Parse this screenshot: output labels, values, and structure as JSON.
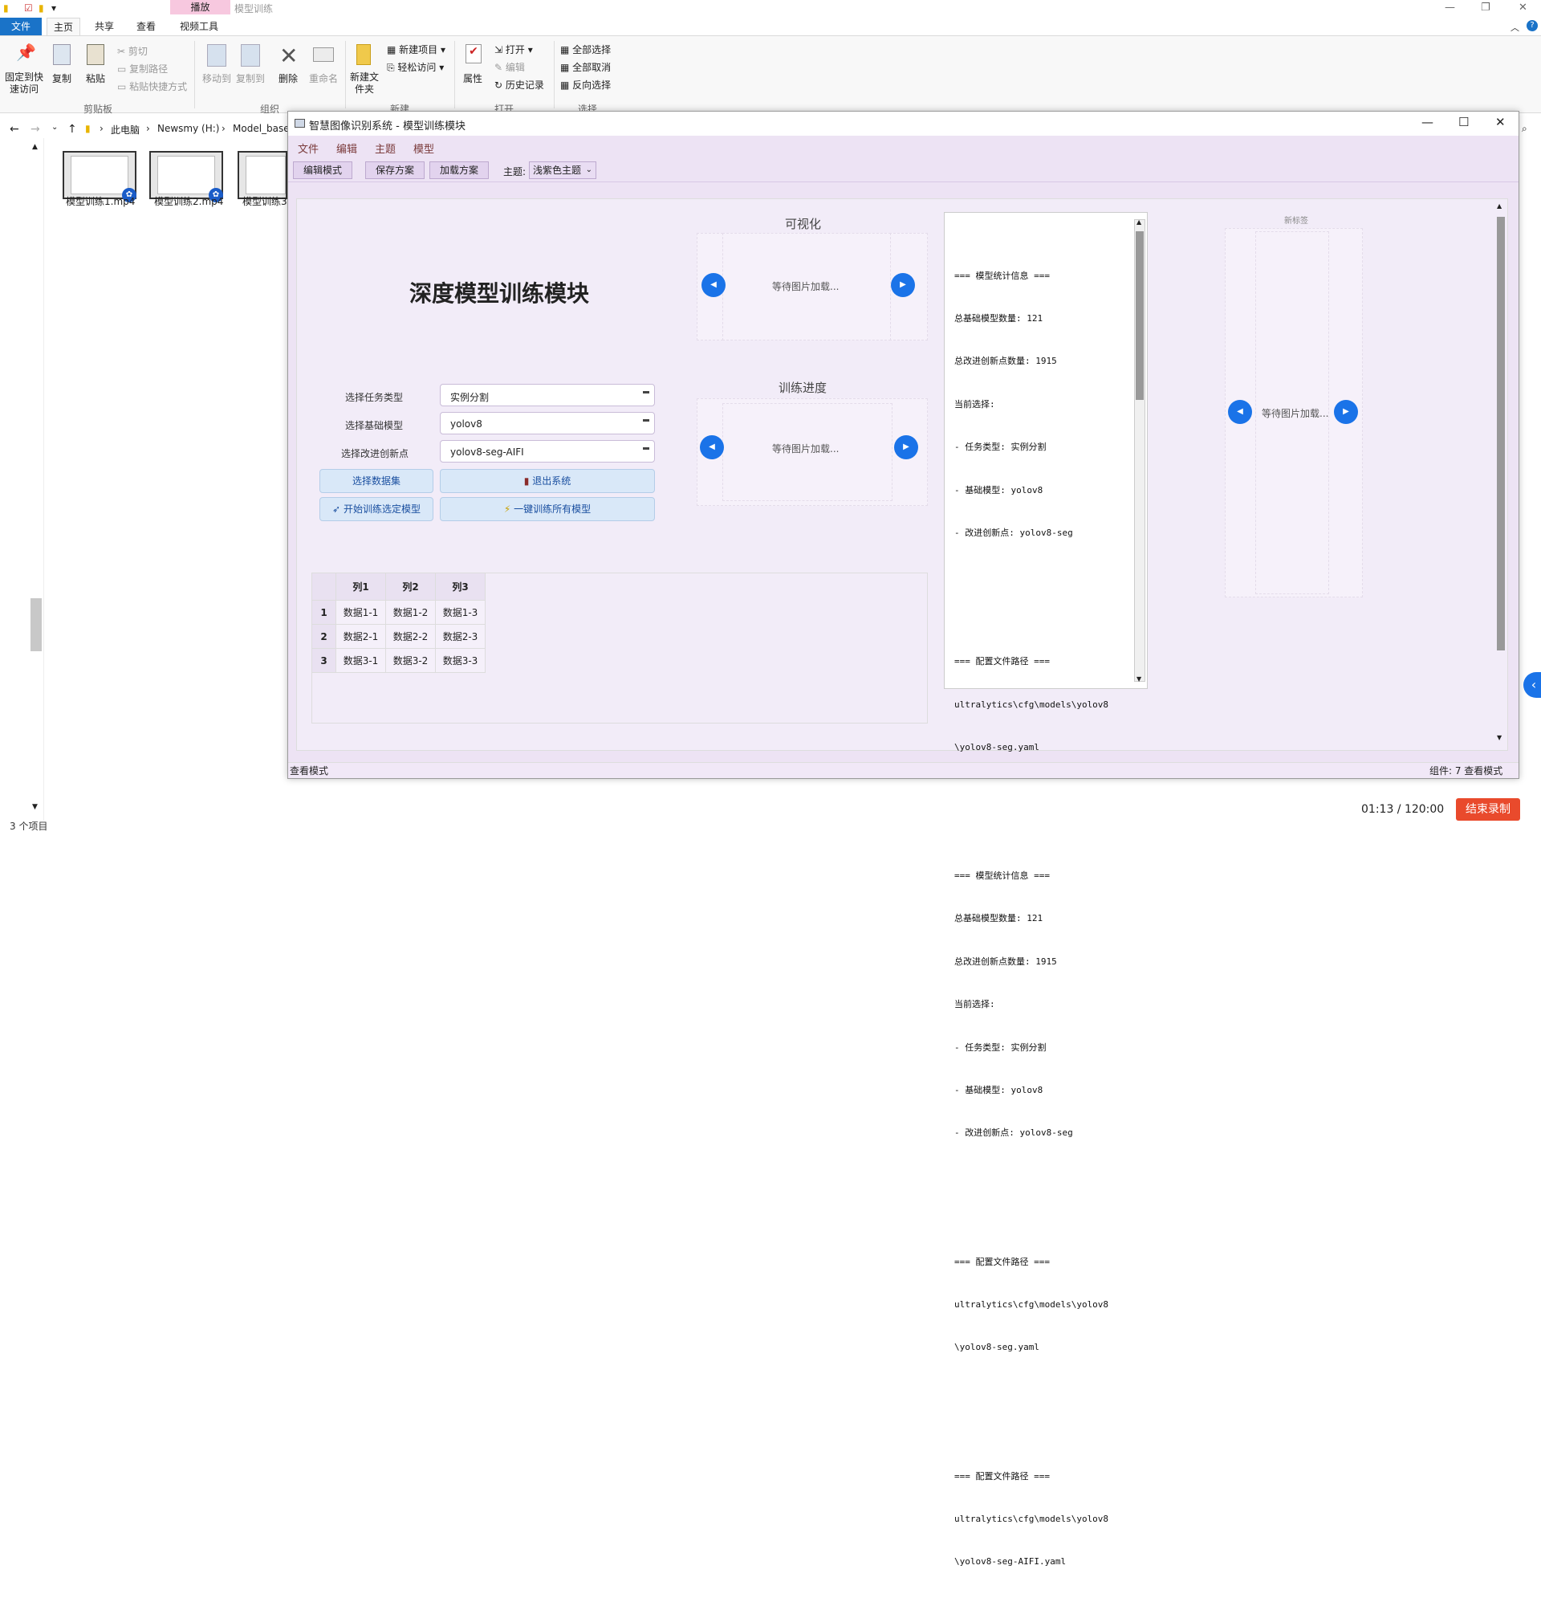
{
  "explorer": {
    "ribbon_tabs": [
      "文件",
      "主页",
      "共享",
      "查看",
      "视频工具"
    ],
    "context_tab": "播放",
    "window_title": "模型训练",
    "clipboard": {
      "pin": "固定到快速访问",
      "copy": "复制",
      "paste": "粘贴",
      "cut": "剪切",
      "copy_path": "复制路径",
      "paste_shortcut": "粘贴快捷方式",
      "group": "剪贴板"
    },
    "organize": {
      "move_to": "移动到",
      "copy_to": "复制到",
      "delete": "删除",
      "rename": "重命名",
      "group": "组织"
    },
    "new": {
      "new_folder": "新建文件夹",
      "new_item": "新建项目",
      "easy_access": "轻松访问",
      "group": "新建"
    },
    "open": {
      "properties": "属性",
      "open": "打开",
      "edit": "编辑",
      "history": "历史记录",
      "group": "打开"
    },
    "select": {
      "select_all": "全部选择",
      "select_none": "全部取消",
      "invert": "反向选择",
      "group": "选择"
    },
    "breadcrumb": [
      "此电脑",
      "Newsmy (H:)",
      "Model_base"
    ],
    "files": [
      "模型训练1.mp4",
      "模型训练2.mp4",
      "模型训练3."
    ],
    "status": "3 个项目"
  },
  "app": {
    "title": "智慧图像识别系统 - 模型训练模块",
    "menu": [
      "文件",
      "编辑",
      "主题",
      "模型"
    ],
    "toolbar": {
      "edit_mode": "编辑模式",
      "save": "保存方案",
      "load": "加载方案",
      "theme_label": "主题:",
      "theme_value": "浅紫色主题"
    },
    "heading": "深度模型训练模块",
    "form": {
      "task_label": "选择任务类型",
      "task_value": "实例分割",
      "base_label": "选择基础模型",
      "base_value": "yolov8",
      "innov_label": "选择改进创新点",
      "innov_value": "yolov8-seg-AIFI"
    },
    "buttons": {
      "dataset": "选择数据集",
      "exit": "退出系统",
      "train_selected": "开始训练选定模型",
      "train_all": "一键训练所有模型"
    },
    "visual_title": "可视化",
    "progress_title": "训练进度",
    "waiting": "等待图片加载...",
    "new_tab": "新标签",
    "log": [
      "=== 模型统计信息 ===",
      "总基础模型数量: 121",
      "总改进创新点数量: 1915",
      "当前选择:",
      "- 任务类型: 实例分割",
      "- 基础模型: yolov8",
      "- 改进创新点: yolov8-seg",
      "",
      "",
      "=== 配置文件路径 ===",
      "ultralytics\\cfg\\models\\yolov8",
      "\\yolov8-seg.yaml",
      "",
      "",
      "=== 模型统计信息 ===",
      "总基础模型数量: 121",
      "总改进创新点数量: 1915",
      "当前选择:",
      "- 任务类型: 实例分割",
      "- 基础模型: yolov8",
      "- 改进创新点: yolov8-seg",
      "",
      "",
      "=== 配置文件路径 ===",
      "ultralytics\\cfg\\models\\yolov8",
      "\\yolov8-seg.yaml",
      "",
      "",
      "=== 配置文件路径 ===",
      "ultralytics\\cfg\\models\\yolov8",
      "\\yolov8-seg-AIFI.yaml"
    ],
    "table": {
      "headers": [
        "列1",
        "列2",
        "列3"
      ],
      "rows": [
        {
          "idx": "1",
          "cells": [
            "数据1-1",
            "数据1-2",
            "数据1-3"
          ]
        },
        {
          "idx": "2",
          "cells": [
            "数据2-1",
            "数据2-2",
            "数据2-3"
          ]
        },
        {
          "idx": "3",
          "cells": [
            "数据3-1",
            "数据3-2",
            "数据3-3"
          ]
        }
      ]
    },
    "status_left": "查看模式",
    "status_right": "组件: 7  查看模式"
  },
  "recorder": {
    "time": "01:13 / 120:00",
    "stop": "结束录制"
  }
}
